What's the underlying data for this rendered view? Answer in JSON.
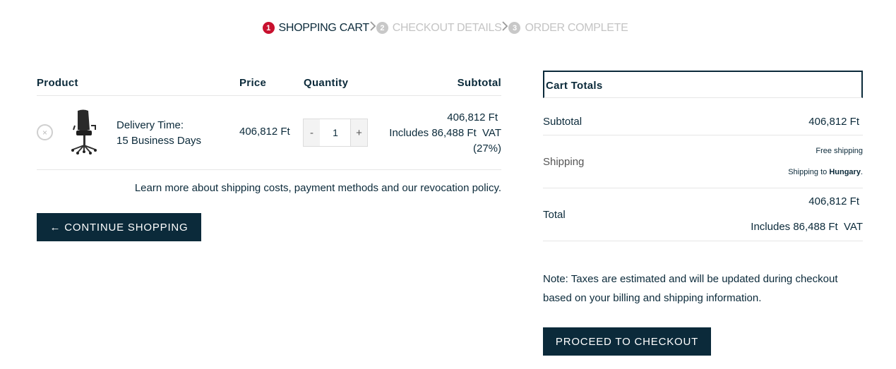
{
  "steps": [
    {
      "num": "1",
      "label": "SHOPPING CART"
    },
    {
      "num": "2",
      "label": "CHECKOUT DETAILS"
    },
    {
      "num": "3",
      "label": "ORDER COMPLETE"
    }
  ],
  "cart": {
    "headers": {
      "product": "Product",
      "price": "Price",
      "quantity": "Quantity",
      "subtotal": "Subtotal"
    },
    "item": {
      "remove": "×",
      "delivery_line1": "Delivery Time:",
      "delivery_line2": "15 Business Days",
      "price": "406,812 Ft",
      "qty_minus": "-",
      "qty_value": "1",
      "qty_plus": "+",
      "subtotal_amount": "406,812 Ft",
      "subtotal_vat": "Includes 86,488 Ft  VAT",
      "subtotal_vat_rate": "(27%)"
    },
    "learn_more": "Learn more about shipping costs, payment methods and our revocation policy.",
    "continue_label": "← CONTINUE SHOPPING"
  },
  "totals": {
    "title": "Cart Totals",
    "subtotal_label": "Subtotal",
    "subtotal_value": "406,812 Ft",
    "shipping_label": "Shipping",
    "shipping_free": "Free shipping",
    "shipping_to_prefix": "Shipping to ",
    "shipping_country": "Hungary",
    "shipping_to_suffix": ".",
    "total_label": "Total",
    "total_value": "406,812 Ft",
    "total_vat": "Includes 86,488 Ft  VAT"
  },
  "note": "Note: Taxes are estimated and will be updated during checkout based on your billing and shipping information.",
  "checkout_label": "PROCEED TO CHECKOUT",
  "colors": {
    "primary": "#0b2a3a",
    "active_step": "#c8102e",
    "inactive": "#c4c4c4"
  }
}
